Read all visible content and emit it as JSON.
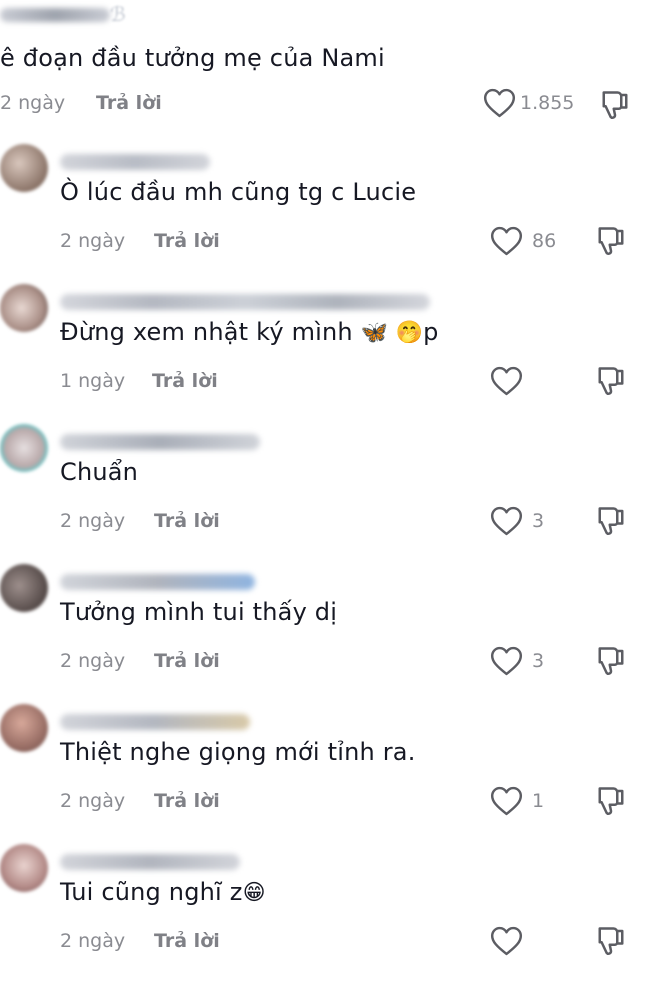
{
  "comments": [
    {
      "text": "ê đoạn đầu tưởng mẹ của Nami",
      "time": "2 ngày",
      "reply": "Trả lời",
      "likes": "1.855"
    },
    {
      "text": "Ò lúc đầu mh cũng tg c Lucie",
      "time": "2 ngày",
      "reply": "Trả lời",
      "likes": "86"
    },
    {
      "text": "Đừng xem nhật ký mình",
      "emoji": "🦋 🤭",
      "suffix": "p",
      "time": "1 ngày",
      "reply": "Trả lời",
      "likes": ""
    },
    {
      "text": "Chuẩn",
      "time": "2 ngày",
      "reply": "Trả lời",
      "likes": "3"
    },
    {
      "text": "Tưởng mình tui thấy dị",
      "time": "2 ngày",
      "reply": "Trả lời",
      "likes": "3"
    },
    {
      "text": "Thiệt nghe giọng mới tỉnh ra.",
      "time": "2 ngày",
      "reply": "Trả lời",
      "likes": "1"
    },
    {
      "text": "Tui cũng nghĩ z",
      "emoji": "😁",
      "time": "2 ngày",
      "reply": "Trả lời",
      "likes": ""
    }
  ],
  "colors": {
    "text": "#161823",
    "muted": "#8a8b91",
    "icon": "#5c5d63"
  }
}
